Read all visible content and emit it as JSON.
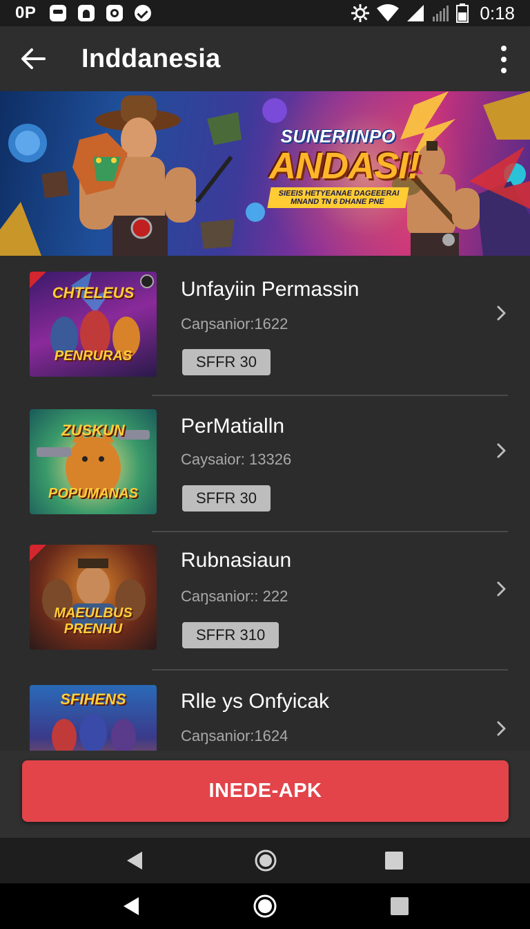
{
  "status_bar": {
    "carrier": "0P",
    "time": "0:18",
    "icons": [
      "message-icon",
      "headset-icon",
      "record-icon",
      "check-shield-icon",
      "brightness-icon",
      "wifi-icon",
      "signal-icon",
      "signal-weak-icon",
      "battery-icon"
    ]
  },
  "app_bar": {
    "title": "Inddanesia",
    "back_icon": "arrow-left-icon",
    "menu_icon": "more-vertical-icon"
  },
  "banner": {
    "logo_line1": "SUNERIINPO",
    "logo_line2": "ANDASI!",
    "logo_line3": "SIEEIS HETYEANAE DAGEEERAI MNAND TN 6 DHANE PNE"
  },
  "list": {
    "items": [
      {
        "title": "Unfayiin Permassin",
        "subtitle": "Caŋsanior:1622",
        "badge": "SFFR 30",
        "thumb_top": "CHTELEUS",
        "thumb_bottom": "PENRURAS"
      },
      {
        "title": "PerMatialln",
        "subtitle": "Caysaior: 13326",
        "badge": "SFFR 30",
        "thumb_top": "ZUSKUN",
        "thumb_bottom": "POPUMANAS"
      },
      {
        "title": "Rubnasiaun",
        "subtitle": "Caŋsanior:: 222",
        "badge": "SFFR 310",
        "thumb_top": "",
        "thumb_bottom": "MAEULBUS PRENHU"
      },
      {
        "title": "Rlle ys Onfyicak",
        "subtitle": "Caŋsanior:1624",
        "badge": "",
        "thumb_top": "SFIHENS",
        "thumb_bottom": ""
      }
    ]
  },
  "cta": {
    "label": "INEDE-APK"
  },
  "nav": {
    "back_icon": "nav-back-icon",
    "home_icon": "nav-home-icon",
    "recents_icon": "nav-recents-icon"
  },
  "colors": {
    "accent": "#e2444a",
    "badge": "#bdbdbd",
    "background": "#2c2c2c"
  }
}
